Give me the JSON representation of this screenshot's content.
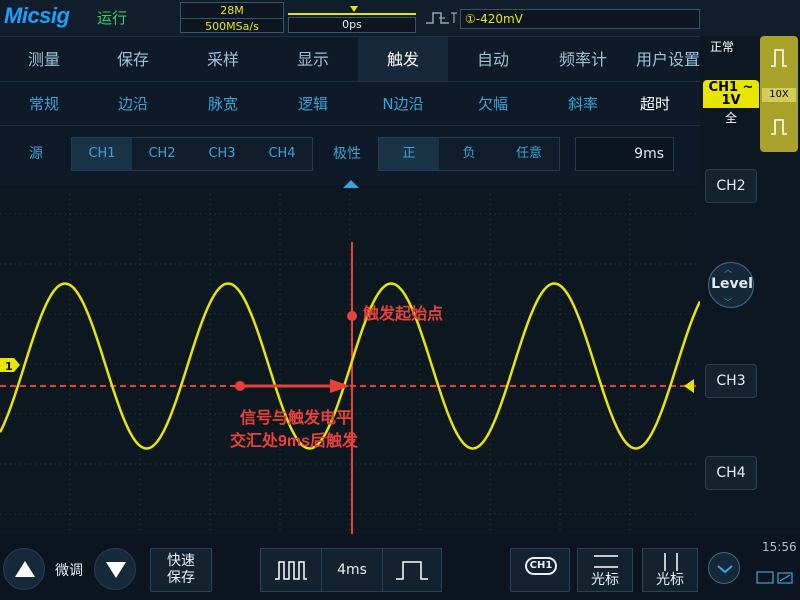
{
  "topbar": {
    "logo": "Micsig",
    "run_state": "运行",
    "memory_depth": "28M",
    "sample_rate": "500MSa/s",
    "trigger_delay": "0ps",
    "trigger_level": "①-420mV"
  },
  "menu_main": [
    "测量",
    "保存",
    "采样",
    "显示",
    "触发",
    "自动",
    "频率计",
    "用户设置"
  ],
  "menu_main_active": "触发",
  "menu_trigger_types": [
    "常规",
    "边沿",
    "脉宽",
    "逻辑",
    "N边沿",
    "欠幅",
    "斜率",
    "超时"
  ],
  "menu_trigger_active": "超时",
  "settings": {
    "source_label": "源",
    "sources": [
      "CH1",
      "CH2",
      "CH3",
      "CH4"
    ],
    "source_active": "CH1",
    "polarity_label": "极性",
    "polarities": [
      "正",
      "负",
      "任意"
    ],
    "polarity_active": "正",
    "timeout_value": "9ms"
  },
  "screen": {
    "channel_marker": "1",
    "annotation_trigger_point": "触发起始点",
    "annotation_line1": "信号与触发电平",
    "annotation_line2": "交汇处9ms后触发",
    "waveform": {
      "type": "sine",
      "color": "#e8e600",
      "period_divisions": 2.33,
      "amplitude_divisions": 1.65
    },
    "trigger_level_color": "#e8413a"
  },
  "rightpanel": {
    "status": "正常",
    "ch1_label": "CH1",
    "ch1_coupling_symbol": "~",
    "ch1_scale": "1V",
    "ch1_bandwidth": "全",
    "probe_ratio": "10X",
    "ch2": "CH2",
    "level": "Level",
    "ch3": "CH3",
    "ch4": "CH4"
  },
  "bottombar": {
    "fine_tune": "微调",
    "quick_save": "快速保存",
    "quick_save_line1": "快速",
    "quick_save_line2": "保存",
    "timebase": "4ms",
    "ch1_badge": "CH1",
    "cursor_h": "光标",
    "cursor_v": "光标",
    "clock": "15:56"
  }
}
